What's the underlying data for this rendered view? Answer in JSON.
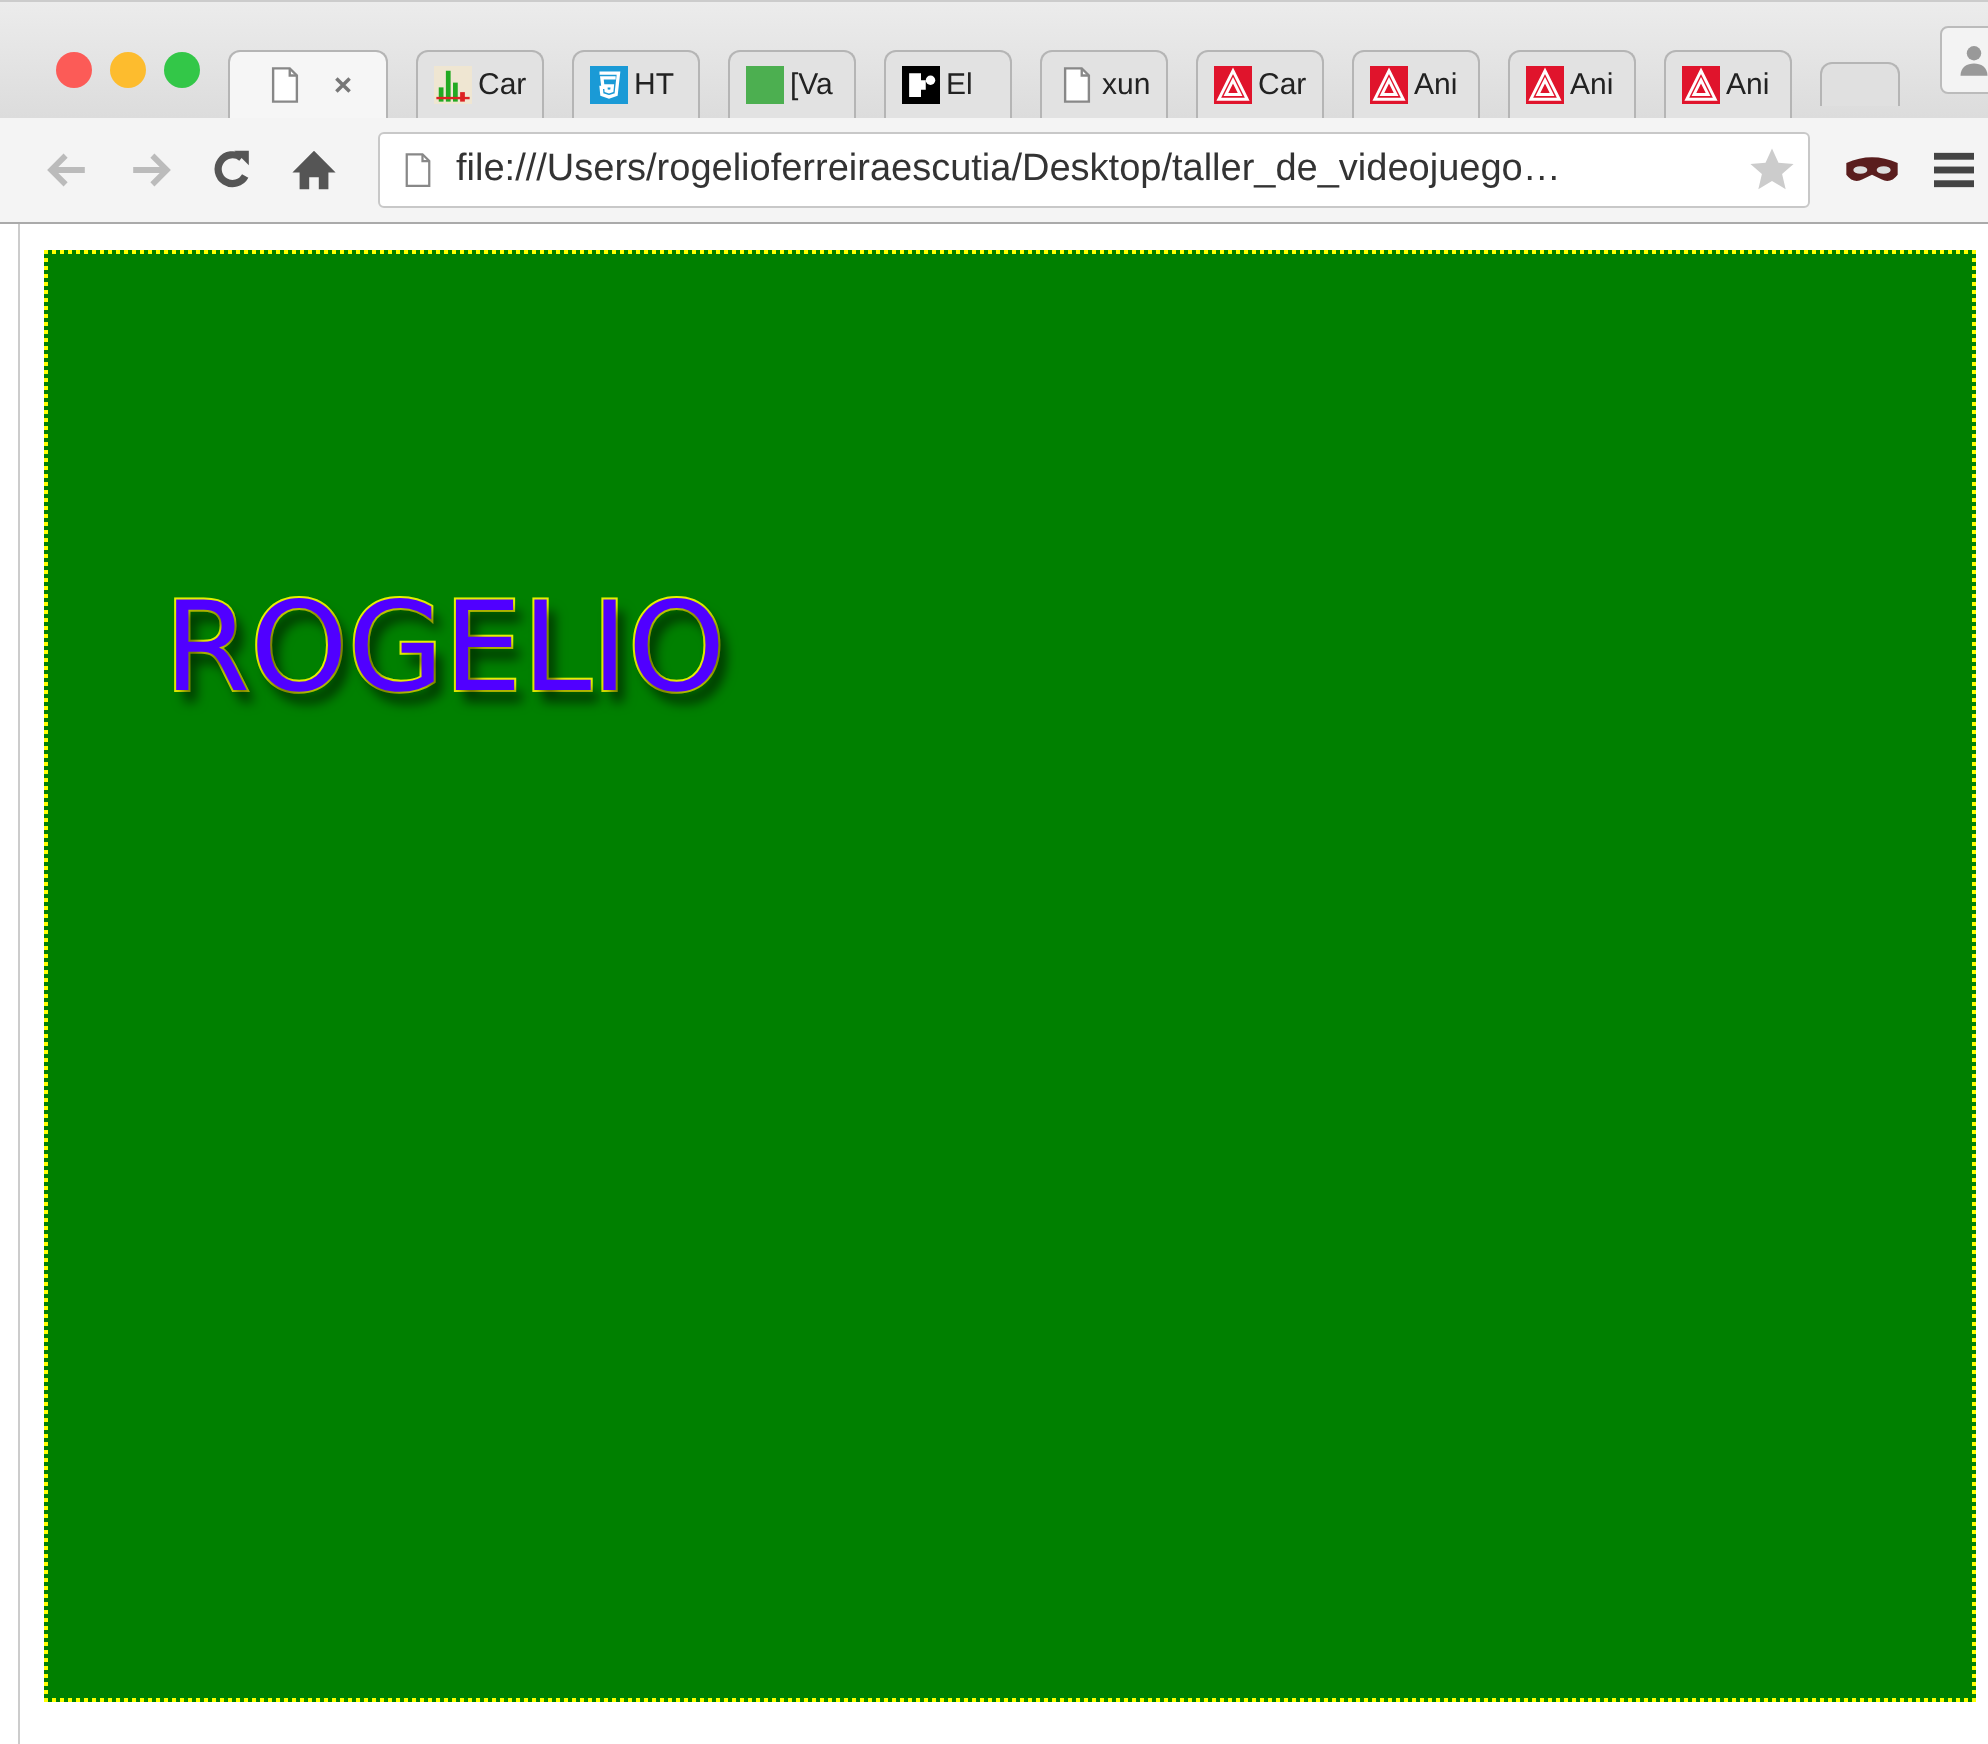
{
  "tabs": [
    {
      "kind": "page",
      "selected": true
    },
    {
      "title": "Car",
      "kind": "chart",
      "selected": false
    },
    {
      "title": "HT",
      "kind": "html5",
      "selected": false
    },
    {
      "title": "[Va",
      "kind": "square",
      "selected": false
    },
    {
      "title": "El",
      "kind": "puzzle",
      "selected": false
    },
    {
      "title": "xun",
      "kind": "page",
      "selected": false
    },
    {
      "title": "Car",
      "kind": "triangle",
      "selected": false
    },
    {
      "title": "Ani",
      "kind": "triangle",
      "selected": false
    },
    {
      "title": "Ani",
      "kind": "triangle",
      "selected": false
    },
    {
      "title": "Ani",
      "kind": "triangle",
      "selected": false
    }
  ],
  "address": {
    "url": "file:///Users/rogelioferreiraescutia/Desktop/taller_de_videojuego…"
  },
  "canvas": {
    "text": "ROGELIO"
  }
}
